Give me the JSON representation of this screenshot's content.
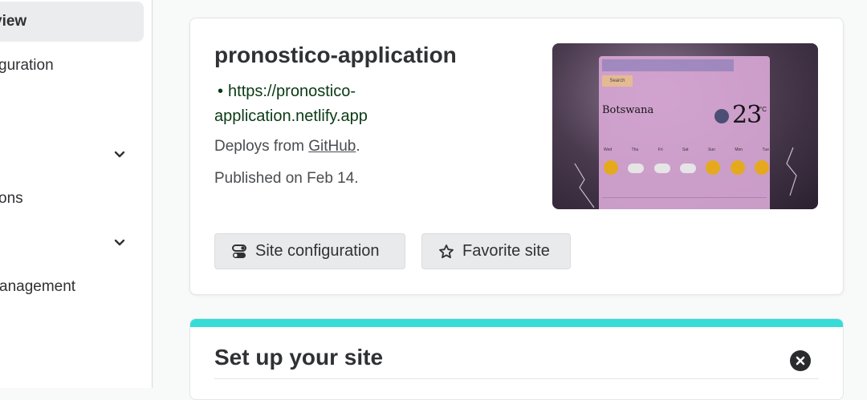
{
  "sidebar": {
    "items": [
      {
        "label": "view",
        "active": true,
        "chevron": false
      },
      {
        "label": "guration",
        "active": false,
        "chevron": false
      },
      {
        "label": "",
        "active": false,
        "chevron": true
      },
      {
        "label": "ons",
        "active": false,
        "chevron": false
      },
      {
        "label": "",
        "active": false,
        "chevron": true
      },
      {
        "label": "anagement",
        "active": false,
        "chevron": false
      }
    ]
  },
  "site": {
    "name": "pronostico-application",
    "url": "https://pronostico-application.netlify.app",
    "deploys_prefix": "Deploys from ",
    "deploys_source": "GitHub",
    "deploys_suffix": ".",
    "published": "Published on Feb 14."
  },
  "actions": {
    "config_label": "Site configuration",
    "favorite_label": "Favorite site"
  },
  "preview": {
    "search_button": "Search",
    "city": "Botswana",
    "temperature": "23",
    "unit": "°C",
    "days": [
      "Wed",
      "Thu",
      "Fri",
      "Sat",
      "Sun",
      "Mon",
      "Tue"
    ]
  },
  "setup": {
    "title": "Set up your site"
  },
  "colors": {
    "accent_bar": "#36dcd8",
    "url_text": "#0a3a14",
    "button_bg": "#e9eaec"
  }
}
